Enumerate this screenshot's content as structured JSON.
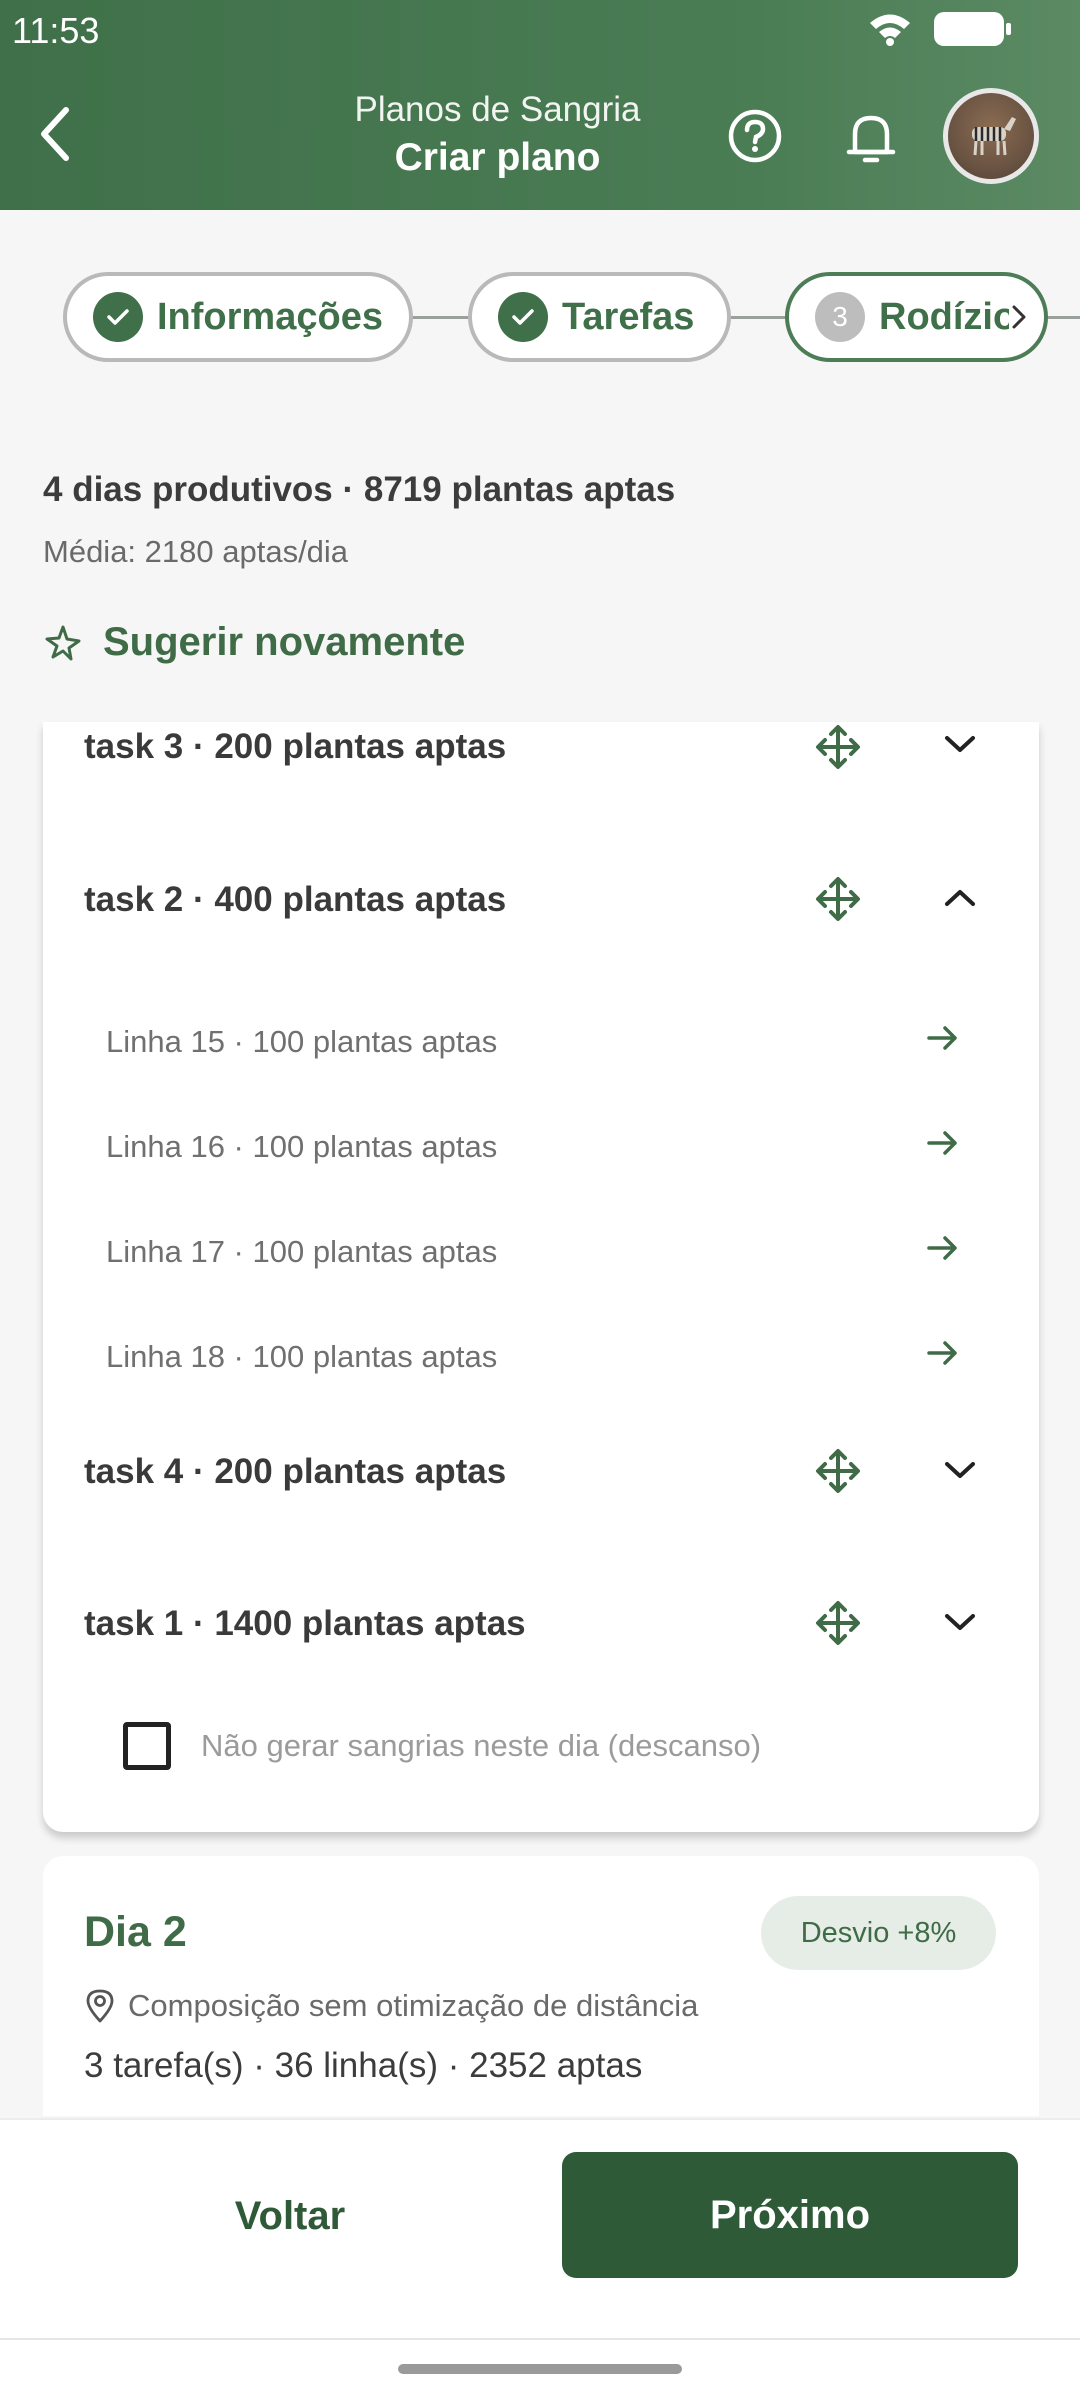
{
  "status_bar": {
    "time": "11:53"
  },
  "header": {
    "subtitle": "Planos de Sangria",
    "title": "Criar plano"
  },
  "stepper": {
    "steps": [
      {
        "label": "Informações",
        "state": "done"
      },
      {
        "label": "Tarefas",
        "state": "done"
      },
      {
        "label": "Rodízio",
        "number": "3",
        "state": "active"
      }
    ]
  },
  "summary": {
    "headline": "4 dias produtivos · 8719 plantas aptas",
    "average": "Média: 2180 aptas/dia",
    "suggest_label": "Sugerir novamente"
  },
  "day1": {
    "tasks": [
      {
        "label": "task 3 · 200 plantas aptas",
        "expanded": false
      },
      {
        "label": "task 2 · 400 plantas aptas",
        "expanded": true,
        "lines": [
          "Linha 15 · 100 plantas aptas",
          "Linha 16 · 100 plantas aptas",
          "Linha 17 · 100 plantas aptas",
          "Linha 18 · 100 plantas aptas"
        ]
      },
      {
        "label": "task 4 · 200 plantas aptas",
        "expanded": false
      },
      {
        "label": "task 1 · 1400 plantas aptas",
        "expanded": false
      }
    ],
    "rest_label": "Não gerar sangrias neste dia (descanso)",
    "rest_checked": false
  },
  "day2": {
    "title": "Dia 2",
    "badge": "Desvio +8%",
    "composition": "Composição sem otimização de distância",
    "counts": "3 tarefa(s) · 36 linha(s) · 2352 aptas"
  },
  "footer": {
    "back_label": "Voltar",
    "next_label": "Próximo"
  },
  "colors": {
    "primary": "#3f7049",
    "primary_dark": "#2e5a38",
    "badge_bg": "#e6ede6"
  }
}
